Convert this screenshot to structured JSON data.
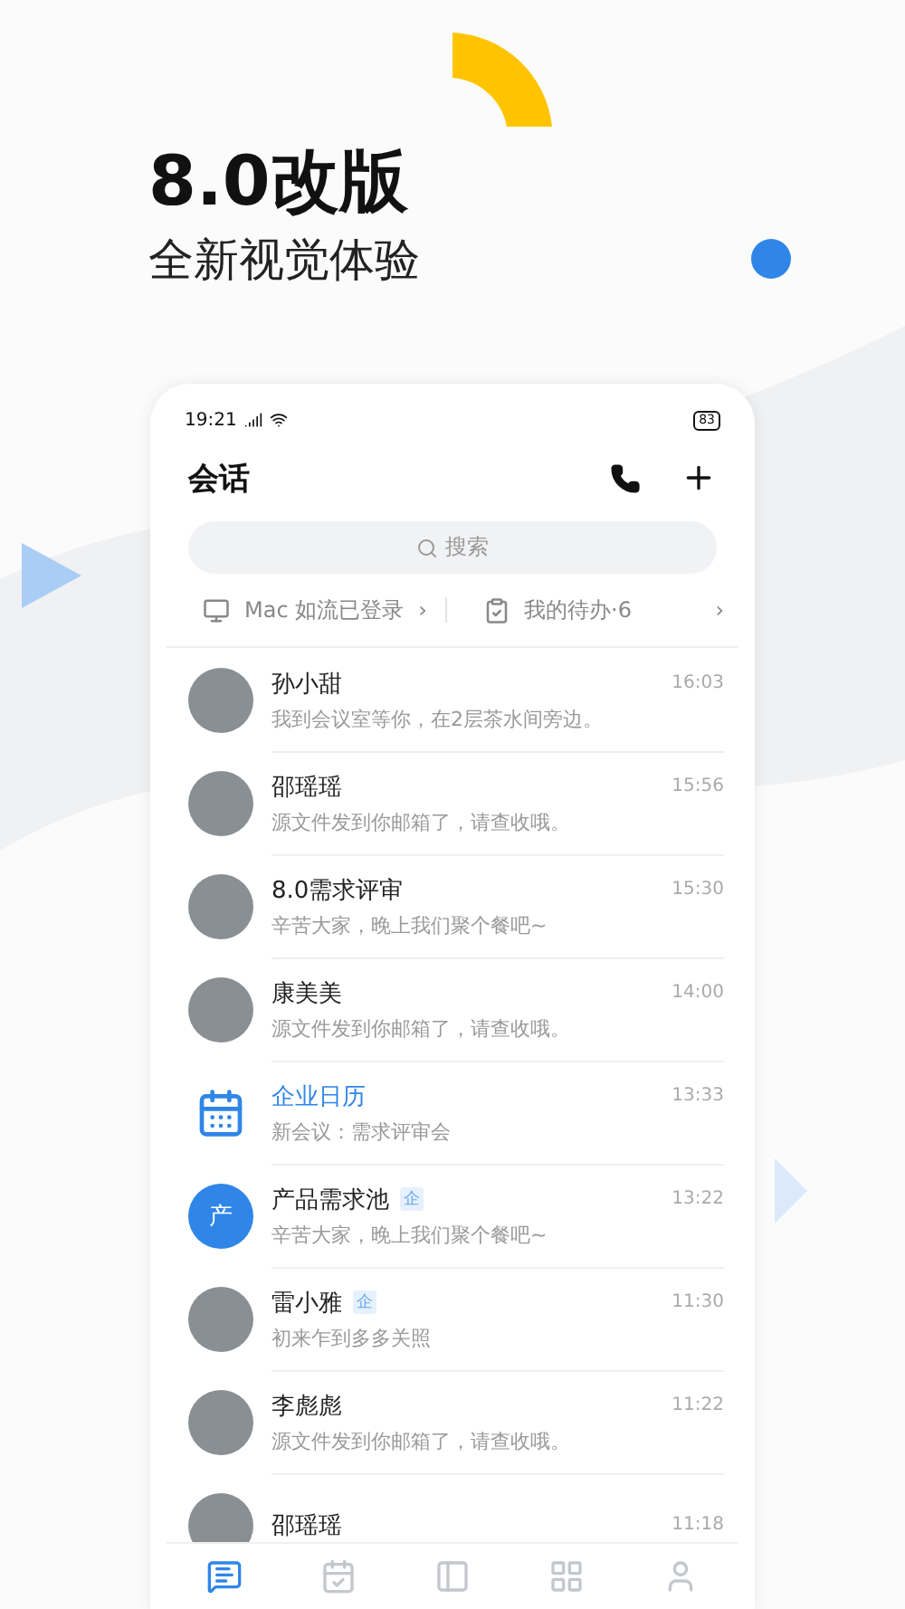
{
  "headline": {
    "title": "8.0改版",
    "subtitle": "全新视觉体验"
  },
  "status_bar": {
    "time": "19:21",
    "battery": "83"
  },
  "header": {
    "title": "会话"
  },
  "search": {
    "placeholder": "搜索"
  },
  "quick_links": [
    {
      "kind": "desktop",
      "label": "Mac 如流已登录",
      "chevron": "›"
    },
    {
      "kind": "todo",
      "label": "我的待办·6",
      "chevron": "›"
    }
  ],
  "conversations": [
    {
      "kind": "photo",
      "name": "孙小甜",
      "message": "我到会议室等你，在2层茶水间旁边。",
      "time": "16:03"
    },
    {
      "kind": "photo",
      "name": "邵瑶瑶",
      "message": "源文件发到你邮箱了，请查收哦。",
      "time": "15:56"
    },
    {
      "kind": "photo",
      "name": "8.0需求评审",
      "message": "辛苦大家，晚上我们聚个餐吧~",
      "time": "15:30"
    },
    {
      "kind": "photo",
      "name": "康美美",
      "message": "源文件发到你邮箱了，请查收哦。",
      "time": "14:00"
    },
    {
      "kind": "calendar",
      "name": "企业日历",
      "message": "新会议：需求评审会",
      "time": "13:33"
    },
    {
      "kind": "initial",
      "initial": "产",
      "name": "产品需求池",
      "badge": "企",
      "message": "辛苦大家，晚上我们聚个餐吧~",
      "time": "13:22"
    },
    {
      "kind": "photo",
      "name": "雷小雅",
      "badge": "企",
      "message": "初来乍到多多关照",
      "time": "11:30"
    },
    {
      "kind": "photo",
      "name": "李彪彪",
      "message": "源文件发到你邮箱了，请查收哦。",
      "time": "11:22"
    },
    {
      "kind": "photo",
      "name": "邵瑶瑶",
      "time": "11:18"
    }
  ],
  "tabs": [
    {
      "kind": "chat",
      "selected": true
    },
    {
      "kind": "calendar",
      "selected": false
    },
    {
      "kind": "docs",
      "selected": false
    },
    {
      "kind": "apps",
      "selected": false
    },
    {
      "kind": "profile",
      "selected": false
    }
  ]
}
